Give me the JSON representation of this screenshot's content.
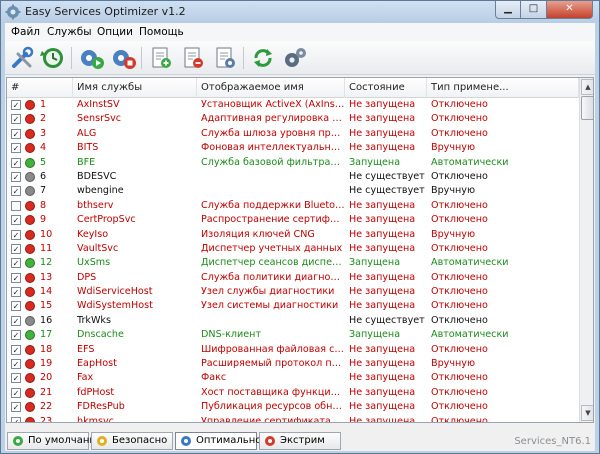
{
  "window": {
    "title": "Easy Services Optimizer v1.2"
  },
  "menu": [
    "Файл",
    "Службы",
    "Опции",
    "Помощь"
  ],
  "toolbar": [
    "tools-icon",
    "refresh-clock-icon",
    "gears-start-icon",
    "gears-stop-icon",
    "add-doc-icon",
    "remove-doc-icon",
    "doc-settings-icon",
    "refresh-icon",
    "gear-icon"
  ],
  "columns": {
    "num": "#",
    "name": "Имя службы",
    "display": "Отображаемое имя",
    "state": "Состояние",
    "type": "Тип примене..."
  },
  "colors": {
    "stopped": "#c00000",
    "running": "#1c8a1c",
    "missing": "#111111",
    "dot_red": "#d92a20",
    "dot_green": "#41b33a",
    "dot_gray": "#8a8a8a"
  },
  "rows": [
    {
      "checked": true,
      "dot": "red",
      "num": "1",
      "name": "AxInstSV",
      "display": "Установщик ActiveX (AxInstSV)",
      "state": "Не запущена",
      "type": "Отключено"
    },
    {
      "checked": true,
      "dot": "red",
      "num": "2",
      "name": "SensrSvc",
      "display": "Адаптивная регулировка ярк...",
      "state": "Не запущена",
      "type": "Отключено"
    },
    {
      "checked": true,
      "dot": "red",
      "num": "3",
      "name": "ALG",
      "display": "Служба шлюза уровня прило...",
      "state": "Не запущена",
      "type": "Отключено"
    },
    {
      "checked": true,
      "dot": "red",
      "num": "4",
      "name": "BITS",
      "display": "Фоновая интеллектуальная с...",
      "state": "Не запущена",
      "type": "Вручную"
    },
    {
      "checked": true,
      "dot": "green",
      "num": "5",
      "name": "BFE",
      "display": "Служба базовой фильтрации",
      "state": "Запущена",
      "type": "Автоматически"
    },
    {
      "checked": true,
      "dot": "gray",
      "num": "6",
      "name": "BDESVC",
      "display": "",
      "state": "Не существует",
      "type": "Отключено"
    },
    {
      "checked": true,
      "dot": "gray",
      "num": "7",
      "name": "wbengine",
      "display": "",
      "state": "Не существует",
      "type": "Вручную"
    },
    {
      "checked": false,
      "dot": "red",
      "num": "8",
      "name": "bthserv",
      "display": "Служба поддержки Bluetooth",
      "state": "Не запущена",
      "type": "Отключено"
    },
    {
      "checked": true,
      "dot": "red",
      "num": "9",
      "name": "CertPropSvc",
      "display": "Распространение сертификата",
      "state": "Не запущена",
      "type": "Отключено"
    },
    {
      "checked": true,
      "dot": "red",
      "num": "10",
      "name": "KeyIso",
      "display": "Изоляция ключей CNG",
      "state": "Не запущена",
      "type": "Вручную"
    },
    {
      "checked": true,
      "dot": "red",
      "num": "11",
      "name": "VaultSvc",
      "display": "Диспетчер учетных данных",
      "state": "Не запущена",
      "type": "Отключено"
    },
    {
      "checked": true,
      "dot": "green",
      "num": "12",
      "name": "UxSms",
      "display": "Диспетчер сеансов диспетче...",
      "state": "Запущена",
      "type": "Автоматически"
    },
    {
      "checked": true,
      "dot": "red",
      "num": "13",
      "name": "DPS",
      "display": "Служба политики диагностики",
      "state": "Не запущена",
      "type": "Отключено"
    },
    {
      "checked": true,
      "dot": "red",
      "num": "14",
      "name": "WdiServiceHost",
      "display": "Узел службы диагностики",
      "state": "Не запущена",
      "type": "Отключено"
    },
    {
      "checked": true,
      "dot": "red",
      "num": "15",
      "name": "WdiSystemHost",
      "display": "Узел системы диагностики",
      "state": "Не запущена",
      "type": "Отключено"
    },
    {
      "checked": true,
      "dot": "gray",
      "num": "16",
      "name": "TrkWks",
      "display": "",
      "state": "Не существует",
      "type": "Отключено"
    },
    {
      "checked": true,
      "dot": "green",
      "num": "17",
      "name": "Dnscache",
      "display": "DNS-клиент",
      "state": "Запущена",
      "type": "Автоматически"
    },
    {
      "checked": true,
      "dot": "red",
      "num": "18",
      "name": "EFS",
      "display": "Шифрованная файловая сист...",
      "state": "Не запущена",
      "type": "Отключено"
    },
    {
      "checked": true,
      "dot": "red",
      "num": "19",
      "name": "EapHost",
      "display": "Расширяемый протокол пров...",
      "state": "Не запущена",
      "type": "Вручную"
    },
    {
      "checked": true,
      "dot": "red",
      "num": "20",
      "name": "Fax",
      "display": "Факс",
      "state": "Не запущена",
      "type": "Отключено"
    },
    {
      "checked": true,
      "dot": "red",
      "num": "21",
      "name": "fdPHost",
      "display": "Хост поставщика функции об...",
      "state": "Не запущена",
      "type": "Отключено"
    },
    {
      "checked": true,
      "dot": "red",
      "num": "22",
      "name": "FDResPub",
      "display": "Публикация ресурсов обнару...",
      "state": "Не запущена",
      "type": "Отключено"
    },
    {
      "checked": true,
      "dot": "red",
      "num": "23",
      "name": "hkmsvc",
      "display": "Управление сертификатами ...",
      "state": "Не запущена",
      "type": "Отключено"
    }
  ],
  "tabs": [
    {
      "label": "По умолчанию",
      "icon": "gear-green-icon"
    },
    {
      "label": "Безопасно",
      "icon": "gear-yellow-icon"
    },
    {
      "label": "Оптимально",
      "icon": "gear-blue-icon"
    },
    {
      "label": "Экстрим",
      "icon": "gear-red-icon"
    }
  ],
  "status": "Services_NT6.1"
}
